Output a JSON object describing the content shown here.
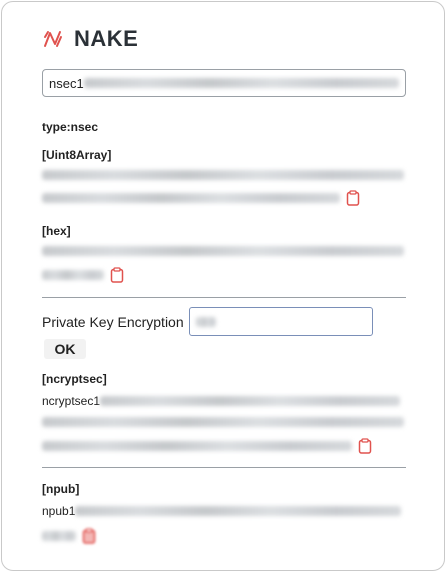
{
  "app": {
    "title": "NAKE"
  },
  "key_input": {
    "value_prefix": "nsec1"
  },
  "type_line": "type:nsec",
  "uint8": {
    "header": "[Uint8Array]"
  },
  "hex": {
    "header": "[hex]"
  },
  "encryption": {
    "label": "Private Key Encryption",
    "ok_label": "OK"
  },
  "ncryptsec": {
    "header": "[ncryptsec]",
    "prefix": "ncryptsec1"
  },
  "npub": {
    "header": "[npub]",
    "prefix": "npub1"
  },
  "icons": {
    "logo": "nake-logo-icon",
    "copy": "clipboard-icon"
  },
  "colors": {
    "accent": "#e0524e",
    "title": "#2b3137"
  }
}
